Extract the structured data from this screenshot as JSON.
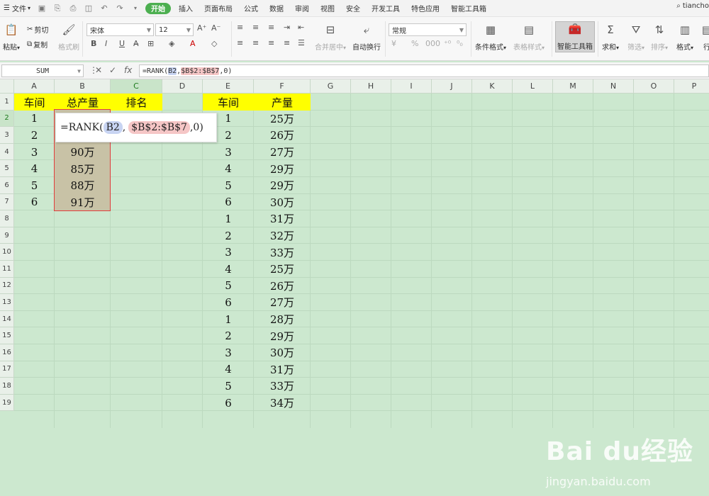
{
  "menubar": {
    "file_label": "文件",
    "tabs": [
      "开始",
      "插入",
      "页面布局",
      "公式",
      "数据",
      "审阅",
      "视图",
      "安全",
      "开发工具",
      "特色应用",
      "智能工具箱"
    ],
    "active_tab": "开始",
    "search_text": "tiancho"
  },
  "ribbon": {
    "paste": "粘贴",
    "cut": "剪切",
    "copy": "复制",
    "format_painter": "格式刷",
    "font_name": "宋体",
    "font_size": "12",
    "merge_center": "合并居中",
    "wrap_text": "自动换行",
    "number_format": "常规",
    "conditional_format": "条件格式",
    "table_style": "表格样式",
    "smart_toolbox": "智能工具箱",
    "sum": "求和",
    "filter": "筛选",
    "sort": "排序",
    "format": "格式",
    "row_col": "行"
  },
  "formula_bar": {
    "name_box": "SUM",
    "fx": "fx",
    "formula_prefix": "=RANK(",
    "ref1": "B2",
    "comma1": ",",
    "ref2": "$B$2:$B$7",
    "suffix": ",0)"
  },
  "columns": [
    "A",
    "B",
    "C",
    "D",
    "E",
    "F",
    "G",
    "H",
    "I",
    "J",
    "K",
    "L",
    "M",
    "N",
    "O",
    "P"
  ],
  "rows": [
    "1",
    "2",
    "3",
    "4",
    "5",
    "6",
    "7",
    "8",
    "9",
    "10",
    "11",
    "12",
    "13",
    "14",
    "15",
    "16",
    "17",
    "18",
    "19"
  ],
  "table1": {
    "headers": [
      "车间",
      "总产量",
      "排名"
    ],
    "workshops": [
      "1",
      "2",
      "3",
      "4",
      "5",
      "6"
    ],
    "outputs": [
      "",
      "",
      "90万",
      "85万",
      "88万",
      "91万"
    ]
  },
  "table2": {
    "headers": [
      "车间",
      "产量"
    ],
    "workshops": [
      "1",
      "2",
      "3",
      "4",
      "5",
      "6",
      "1",
      "2",
      "3",
      "4",
      "5",
      "6",
      "1",
      "2",
      "3",
      "4",
      "5",
      "6"
    ],
    "outputs": [
      "25万",
      "26万",
      "27万",
      "29万",
      "29万",
      "30万",
      "31万",
      "32万",
      "33万",
      "25万",
      "26万",
      "27万",
      "28万",
      "29万",
      "30万",
      "31万",
      "33万",
      "34万"
    ]
  },
  "tooltip": {
    "prefix": "=RANK(",
    "ref1": "B2",
    "comma1": ",",
    "ref2": "$B$2:$B$7",
    "suffix": ",0)"
  },
  "watermark": {
    "brand": "Bai du经验",
    "url": "jingyan.baidu.com"
  }
}
